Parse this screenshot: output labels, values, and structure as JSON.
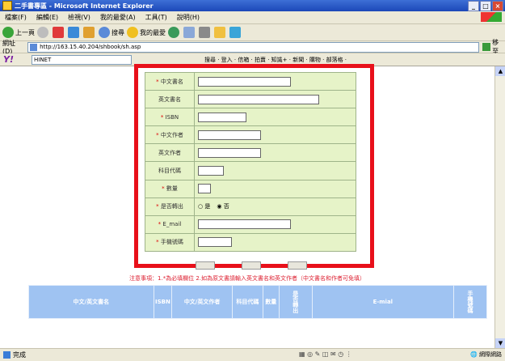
{
  "window": {
    "title": "二手書專區 - Microsoft Internet Explorer",
    "controls": [
      "_",
      "□",
      "×"
    ]
  },
  "menu": {
    "items": [
      "檔案(F)",
      "編輯(E)",
      "檢視(V)",
      "我的最愛(A)",
      "工具(T)",
      "說明(H)"
    ]
  },
  "toolbar": {
    "back_label": "上一頁",
    "search_label": "搜尋",
    "favorites_label": "我的最愛"
  },
  "address": {
    "label": "網址(D)",
    "url": "http://163.15.40.204/shbook/sh.asp",
    "go_label": "移至"
  },
  "yahoo_toolbar": {
    "logo": "Y!",
    "search_value": "HINET",
    "links": "搜尋 · 登入 · 信箱 · 拍賣 · 知識+ · 新聞 · 購物 · 部落格 ·"
  },
  "form": {
    "fields": [
      {
        "label": "中文書名",
        "required": true,
        "input_width": 113
      },
      {
        "label": "英文書名",
        "required": false,
        "input_width": 148
      },
      {
        "label": "ISBN",
        "required": true,
        "input_width": 58
      },
      {
        "label": "中文作者",
        "required": true,
        "input_width": 76
      },
      {
        "label": "英文作者",
        "required": false,
        "input_width": 76
      },
      {
        "label": "科目代碼",
        "required": false,
        "input_width": 30
      },
      {
        "label": "數量",
        "required": true,
        "input_width": 14
      },
      {
        "label": "是否轉出",
        "required": true,
        "input_width": 0
      },
      {
        "label": "E_mail",
        "required": true,
        "input_width": 113
      },
      {
        "label": "手機號碼",
        "required": true,
        "input_width": 40
      }
    ],
    "radio_yes": "是",
    "radio_no": "否",
    "required_mark": "*"
  },
  "note": "注意事項：1.*為必填欄位 2.如為原文書請輸入英文書名和英文作者（中文書名和作者可免填）",
  "table": {
    "headers": [
      "中文/英文書名",
      "ISBN",
      "中文/英文作者",
      "科目代碼",
      "數量",
      "是否轉出",
      "E-mial",
      "手機號碼"
    ]
  },
  "status": {
    "text": "完成",
    "zone": "網際網路"
  }
}
